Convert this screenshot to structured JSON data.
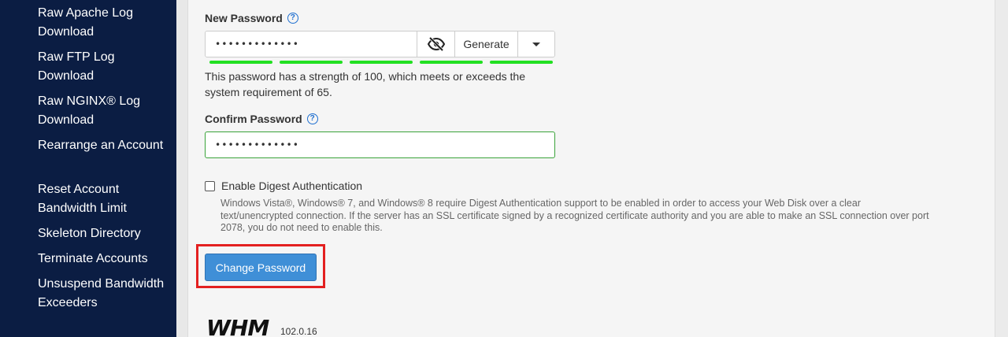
{
  "sidebar": {
    "items": [
      {
        "label": "Raw Apache Log Download"
      },
      {
        "label": "Raw FTP Log Download"
      },
      {
        "label": "Raw NGINX® Log Download"
      },
      {
        "label": "Rearrange an Account"
      },
      {
        "label": "Reset Account Bandwidth Limit"
      },
      {
        "label": "Skeleton Directory"
      },
      {
        "label": "Terminate Accounts"
      },
      {
        "label": "Unsuspend Bandwidth Exceeders"
      }
    ]
  },
  "form": {
    "new_password_label": "New Password",
    "new_password_value": "•••••••••••••",
    "generate_label": "Generate",
    "strength_message": "This password has a strength of 100, which meets or exceeds the system requirement of 65.",
    "strength_percent": 100,
    "confirm_password_label": "Confirm Password",
    "confirm_password_value": "•••••••••••••",
    "digest_label": "Enable Digest Authentication",
    "digest_checked": false,
    "digest_note": "Windows Vista®, Windows® 7, and Windows® 8 require Digest Authentication support to be enabled in order to access your Web Disk over a clear text/unencrypted connection. If the server has an SSL certificate signed by a recognized certificate authority and you are able to make an SSL connection over port 2078, you do not need to enable this.",
    "submit_label": "Change Password"
  },
  "footer": {
    "logo": "WHM",
    "version": "102.0.16"
  },
  "colors": {
    "sidebar_bg": "#0b1d43",
    "strength_bar": "#22e022",
    "primary_button": "#3f8fd7",
    "highlight": "#e32020",
    "help_icon": "#1e6fd0"
  }
}
